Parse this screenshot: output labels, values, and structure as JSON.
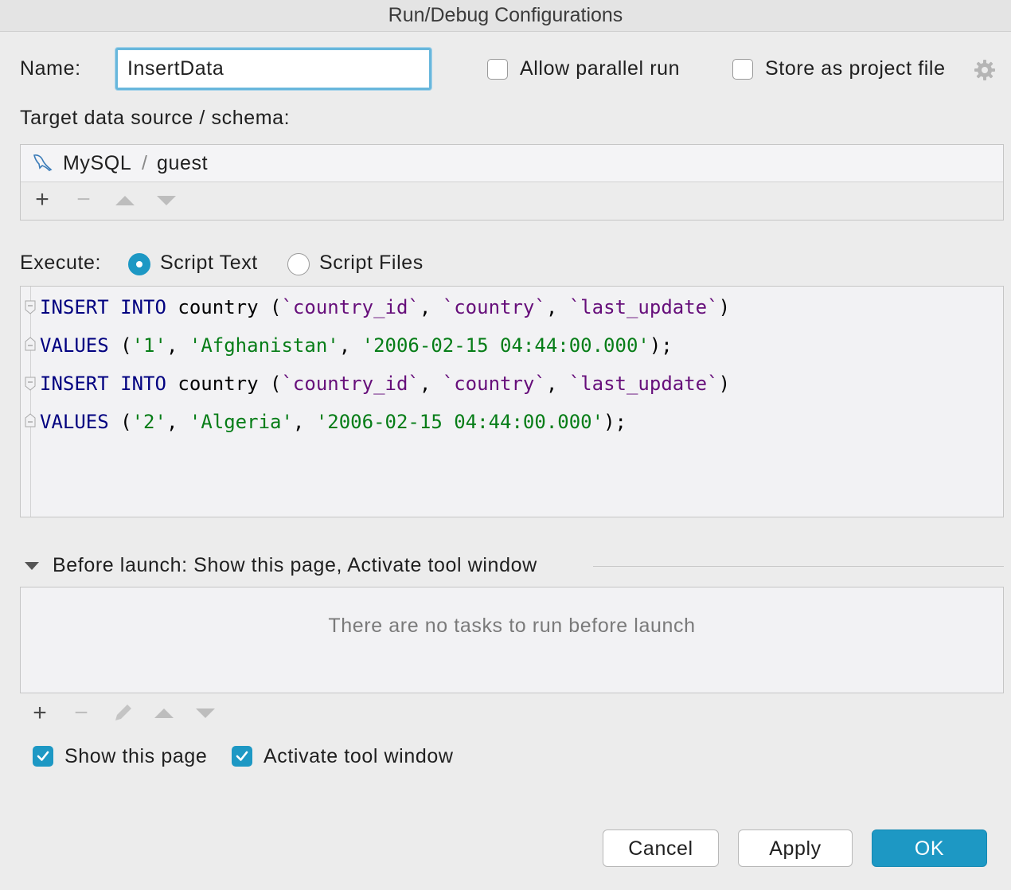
{
  "window": {
    "title": "Run/Debug Configurations"
  },
  "name_row": {
    "label": "Name:",
    "value": "InsertData",
    "allow_parallel_label": "Allow parallel run",
    "allow_parallel_checked": false,
    "store_project_label": "Store as project file",
    "store_project_checked": false
  },
  "target": {
    "label": "Target data source / schema:",
    "source": "MySQL",
    "separator": "/",
    "schema": "guest",
    "toolbar": [
      "add-icon",
      "remove-icon",
      "move-up-icon",
      "move-down-icon"
    ]
  },
  "execute": {
    "label": "Execute:",
    "options": [
      {
        "label": "Script Text",
        "selected": true
      },
      {
        "label": "Script Files",
        "selected": false
      }
    ]
  },
  "script": {
    "lines": [
      {
        "kw1": "INSERT",
        "kw2": "INTO",
        "table": "country",
        "c1": "`country_id`",
        "c2": "`country`",
        "c3": "`last_update`"
      },
      {
        "kw": "VALUES",
        "v1": "'1'",
        "v2": "'Afghanistan'",
        "v3": "'2006-02-15 04:44:00.000'"
      },
      {
        "kw1": "INSERT",
        "kw2": "INTO",
        "table": "country",
        "c1": "`country_id`",
        "c2": "`country`",
        "c3": "`last_update`"
      },
      {
        "kw": "VALUES",
        "v1": "'2'",
        "v2": "'Algeria'",
        "v3": "'2006-02-15 04:44:00.000'"
      }
    ]
  },
  "before_launch": {
    "header": "Before launch: Show this page, Activate tool window",
    "empty_text": "There are no tasks to run before launch",
    "toolbar": [
      "add-icon",
      "remove-icon",
      "edit-icon",
      "move-up-icon",
      "move-down-icon"
    ],
    "show_page_label": "Show this page",
    "show_page_checked": true,
    "activate_tool_label": "Activate tool window",
    "activate_tool_checked": true
  },
  "buttons": {
    "cancel": "Cancel",
    "apply": "Apply",
    "ok": "OK"
  },
  "colors": {
    "accent": "#1d98c4",
    "keyword": "#000080",
    "identifier": "#660e7a",
    "string": "#067d17"
  }
}
